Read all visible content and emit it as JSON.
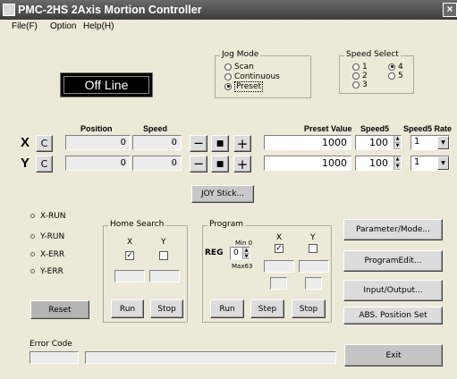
{
  "window": {
    "title": "PMC-2HS 2Axis Mortion Controller",
    "close": "×"
  },
  "menu": [
    "File(F)",
    "Option",
    "Help(H)"
  ],
  "status": "Off Line",
  "jog_mode": {
    "label": "Jog Mode",
    "options": [
      "Scan",
      "Continuous",
      "Preset"
    ],
    "selected": "Preset"
  },
  "speed_select": {
    "label": "Speed Select",
    "options": [
      "1",
      "4",
      "2",
      "5",
      "3"
    ],
    "selected": "4"
  },
  "axes_header": {
    "position": "Position",
    "speed": "Speed",
    "preset_value": "Preset Value",
    "speed5": "Speed5",
    "speed5_rate": "Speed5 Rate"
  },
  "axes": [
    {
      "name": "X",
      "c": "C",
      "position": "0",
      "speed": "0",
      "minus": "—",
      "stop": "■",
      "plus": "+",
      "preset": "1000",
      "speed5": "100",
      "rate": "1"
    },
    {
      "name": "Y",
      "c": "C",
      "position": "0",
      "speed": "0",
      "minus": "—",
      "stop": "■",
      "plus": "+",
      "preset": "1000",
      "speed5": "100",
      "rate": "1"
    }
  ],
  "joystick": "JOY Stick...",
  "indicators": [
    "X-RUN",
    "Y-RUN",
    "X-ERR",
    "Y-ERR"
  ],
  "reset": "Reset",
  "home_search": {
    "label": "Home Search",
    "x": "X",
    "y": "Y",
    "x_checked": true,
    "y_checked": false,
    "run": "Run",
    "stop": "Stop"
  },
  "program": {
    "label": "Program",
    "reg": "REG",
    "min": "Min 0",
    "max": "Max63",
    "reg_value": "0",
    "x": "X",
    "y": "Y",
    "x_checked": true,
    "y_checked": false,
    "run": "Run",
    "step": "Step",
    "stop": "Stop"
  },
  "side_buttons": [
    "Parameter/Mode...",
    "ProgramEdit...",
    "Input/Output...",
    "ABS. Position Set"
  ],
  "error_code": "Error Code",
  "exit": "Exit"
}
